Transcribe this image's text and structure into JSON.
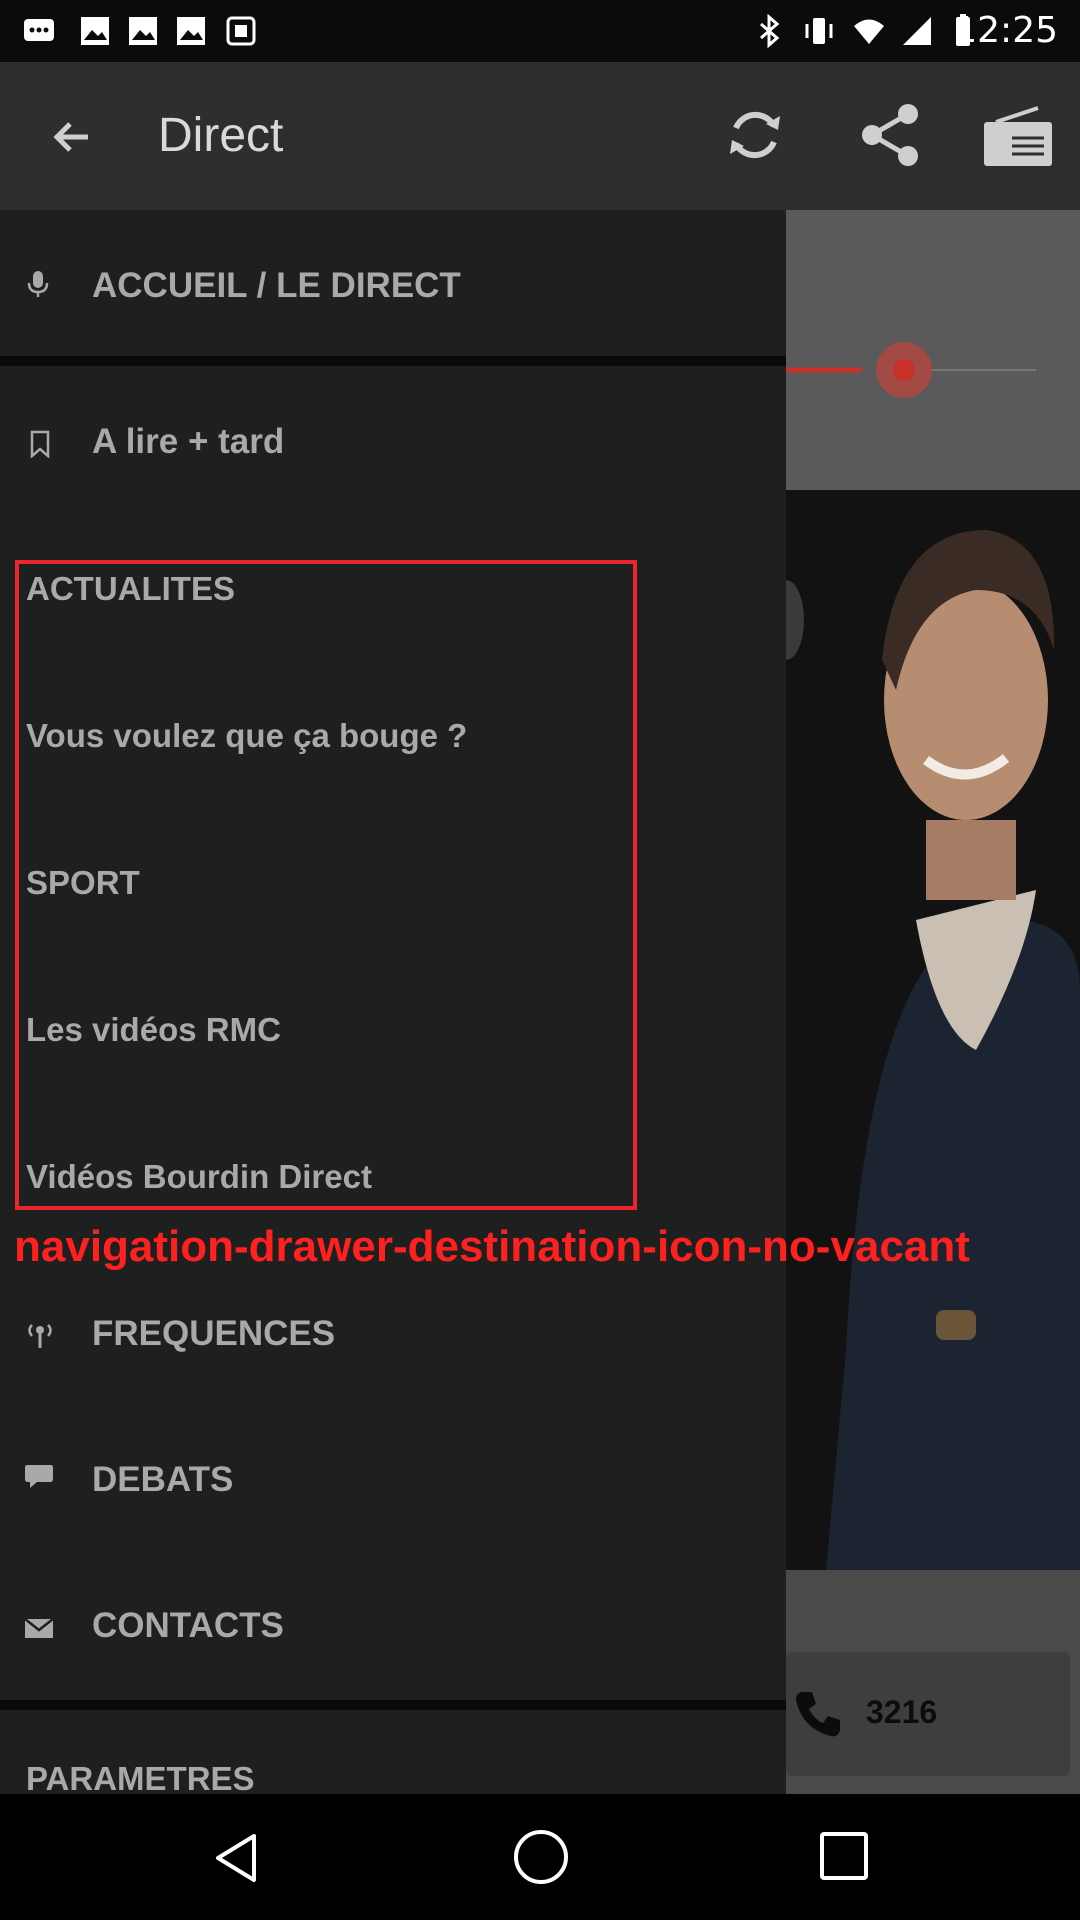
{
  "status_bar": {
    "time": "12:25"
  },
  "app_bar": {
    "title": "Direct",
    "back_icon": "arrow-back-icon",
    "actions": [
      "refresh-icon",
      "share-icon",
      "radio-icon"
    ]
  },
  "drawer": {
    "primary_items": [
      {
        "label": "ACCUEIL / LE DIRECT",
        "icon": "microphone-icon"
      },
      {
        "label": "A lire + tard",
        "icon": "bookmark-icon"
      }
    ],
    "sections": [
      {
        "label": "ACTUALITES"
      },
      {
        "label": "Vous voulez que ça bouge ?"
      },
      {
        "label": "SPORT"
      },
      {
        "label": "Les vidéos RMC"
      },
      {
        "label": "Vidéos Bourdin Direct"
      }
    ],
    "highlight_label": "navigation-drawer-destination-icon-no-vacant",
    "secondary_items": [
      {
        "label": "FREQUENCES",
        "icon": "antenna-icon"
      },
      {
        "label": "DEBATS",
        "icon": "chat-bubble-icon"
      },
      {
        "label": "CONTACTS",
        "icon": "mail-icon"
      }
    ],
    "footer_label": "PARAMETRES"
  },
  "background": {
    "call_number": "3216"
  },
  "colors": {
    "drawer_bg": "#1e1f1f",
    "highlight": "#e8262b",
    "accent": "#c8322b"
  }
}
